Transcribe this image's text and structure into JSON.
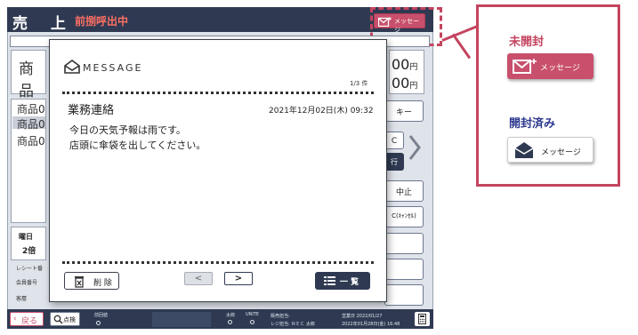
{
  "pos": {
    "title": "売 上",
    "status": "前捌呼出中",
    "message_button": "メッセージ",
    "product_header": "商品",
    "amount_1": "00",
    "amount_2": "00",
    "yen": "円",
    "list_items": [
      "商品0",
      "商品0",
      "商品0"
    ],
    "right_buttons": [
      "キー",
      "C",
      "行",
      "中止",
      "C(ｷｬﾝｾﾙ)"
    ],
    "weekday_label": "曜日",
    "multiplier": "2倍",
    "receipt_label": "レシート番",
    "member_label": "会員番号",
    "customer_label": "客層",
    "back_button": "戻る",
    "check_button": "点検",
    "bottom": {
      "prev_label": "前回値",
      "tax_label": "太郎",
      "unit_label": "UNITE",
      "sales_staff": "販売担当:",
      "register_staff": "レジ担当: ＮＥＣ 太郎",
      "business_date": "営業日 2022/01/27",
      "datetime": "2022年01月28日(金) 16:48"
    }
  },
  "modal": {
    "logo_text": "MESSAGE",
    "page_count": "1/3 件",
    "subject": "業務連絡",
    "datetime": "2021年12月02日(木) 09:32",
    "body_lines": [
      "今日の天気予報は雨です。",
      "店頭に傘袋を出してください。"
    ],
    "delete_button": "削 除",
    "prev_button": "<",
    "next_button": ">",
    "list_button": "一 覧"
  },
  "legend": {
    "unread_title": "未開封",
    "unread_button": "メッセージ",
    "read_title": "開封済み",
    "read_button": "メッセージ"
  },
  "colors": {
    "accent_red": "#c8506c",
    "navy": "#2f3a52",
    "status_red": "#ff6f63"
  }
}
